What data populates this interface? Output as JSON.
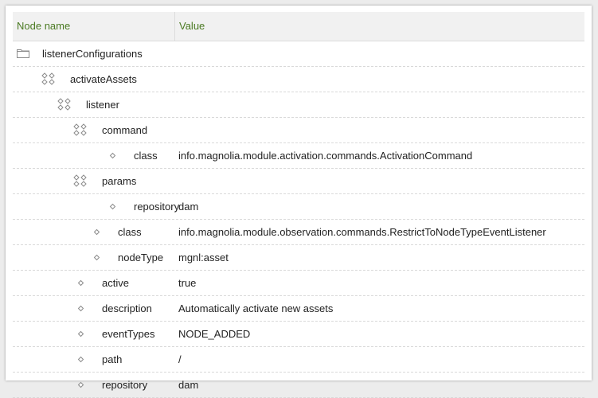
{
  "columns": {
    "name": "Node name",
    "value": "Value"
  },
  "rows": [
    {
      "name": "listenerConfigurations",
      "value": "",
      "icon": "folder-icon",
      "depth": 0
    },
    {
      "name": "activateAssets",
      "value": "",
      "icon": "content-node-icon",
      "depth": 1
    },
    {
      "name": "listener",
      "value": "",
      "icon": "content-node-icon",
      "depth": 2
    },
    {
      "name": "command",
      "value": "",
      "icon": "content-node-icon",
      "depth": 3
    },
    {
      "name": "class",
      "value": "info.magnolia.module.activation.commands.ActivationCommand",
      "icon": "property-icon",
      "depth": 4
    },
    {
      "name": "params",
      "value": "",
      "icon": "content-node-icon",
      "depth": 3
    },
    {
      "name": "repository",
      "value": "dam",
      "icon": "property-icon",
      "depth": 4
    },
    {
      "name": "class",
      "value": "info.magnolia.module.observation.commands.RestrictToNodeTypeEventListener",
      "icon": "property-icon",
      "depth": 3
    },
    {
      "name": "nodeType",
      "value": "mgnl:asset",
      "icon": "property-icon",
      "depth": 3
    },
    {
      "name": "active",
      "value": "true",
      "icon": "property-icon",
      "depth": 2
    },
    {
      "name": "description",
      "value": "Automatically activate new assets",
      "icon": "property-icon",
      "depth": 2
    },
    {
      "name": "eventTypes",
      "value": "NODE_ADDED",
      "icon": "property-icon",
      "depth": 2
    },
    {
      "name": "path",
      "value": "/",
      "icon": "property-icon",
      "depth": 2
    },
    {
      "name": "repository",
      "value": "dam",
      "icon": "property-icon",
      "depth": 2
    }
  ]
}
